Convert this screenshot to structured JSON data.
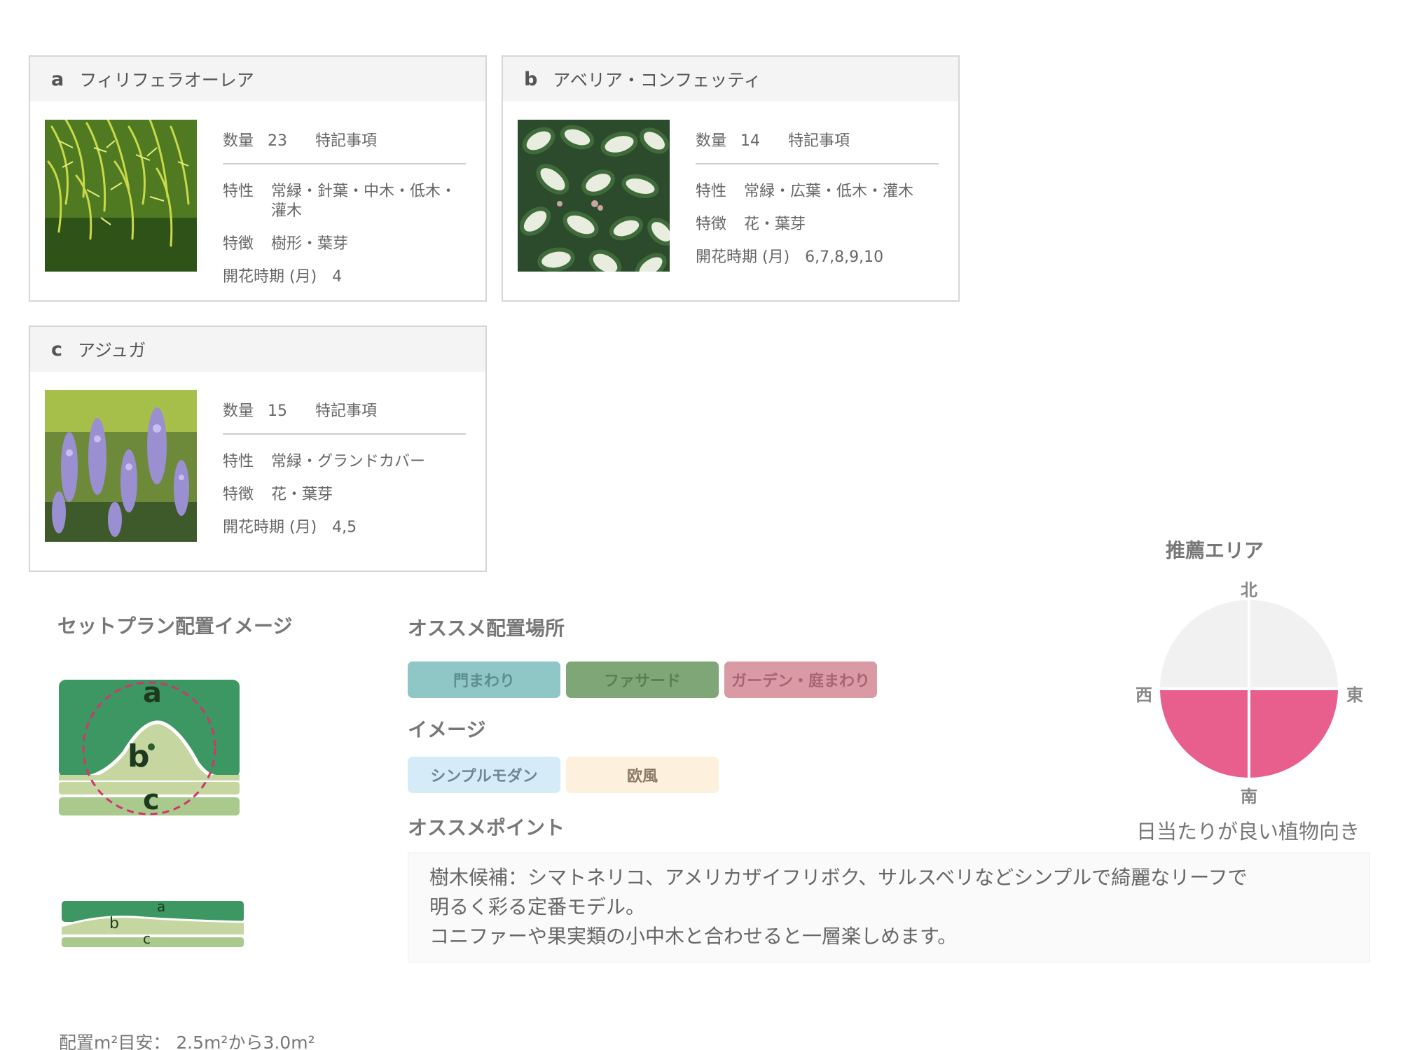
{
  "plants": [
    {
      "letter": "a",
      "name": "フィリフェラオーレア",
      "qty_label": "数量",
      "qty": "23",
      "note_label": "特記事項",
      "traits_label": "特性",
      "traits": "常緑・針葉・中木・低木・灌木",
      "features_label": "特徴",
      "features": "樹形・葉芽",
      "bloom_label": "開花時期 (月)",
      "bloom": "4",
      "photo_icon": "conifer-foliage-photo"
    },
    {
      "letter": "b",
      "name": "アベリア・コンフェッティ",
      "qty_label": "数量",
      "qty": "14",
      "note_label": "特記事項",
      "traits_label": "特性",
      "traits": "常緑・広葉・低木・灌木",
      "features_label": "特徴",
      "features": "花・葉芽",
      "bloom_label": "開花時期 (月)",
      "bloom": "6,7,8,9,10",
      "photo_icon": "variegated-leaves-photo"
    },
    {
      "letter": "c",
      "name": "アジュガ",
      "qty_label": "数量",
      "qty": "15",
      "note_label": "特記事項",
      "traits_label": "特性",
      "traits": "常緑・グランドカバー",
      "features_label": "特徴",
      "features": "花・葉芽",
      "bloom_label": "開花時期 (月)",
      "bloom": "4,5",
      "photo_icon": "purple-flower-photo"
    }
  ],
  "plan": {
    "title": "セットプラン配置イメージ",
    "labels": [
      "a",
      "b",
      "c"
    ],
    "area_text": "配置m²目安： 2.5m²から3.0m²"
  },
  "placement": {
    "title": "オススメ配置場所",
    "tags": [
      {
        "label": "門まわり",
        "bg": "#8fc6c6",
        "fg": "#5e8e8e"
      },
      {
        "label": "ファサード",
        "bg": "#7ea676",
        "fg": "#5a8052"
      },
      {
        "label": "ガーデン・庭まわり",
        "bg": "#d99aa6",
        "fg": "#a86474"
      }
    ]
  },
  "image": {
    "title": "イメージ",
    "tags": [
      {
        "label": "シンプルモダン",
        "bg": "#d5ecf8",
        "fg": "#6e8594"
      },
      {
        "label": "欧風",
        "bg": "#fdf0dc",
        "fg": "#8a7a66"
      }
    ]
  },
  "point": {
    "title": "オススメポイント",
    "lines": [
      "樹木候補：シマトネリコ、アメリカザイフリボク、サルスベリなどシンプルで綺麗なリーフで",
      "明るく彩る定番モデル。",
      "コニファーや果実類の小中木と合わせると一層楽しめます。"
    ]
  },
  "area": {
    "title": "推薦エリア",
    "north": "北",
    "south": "南",
    "east": "東",
    "west": "西",
    "caption": "日当たりが良い植物向き",
    "highlighted": [
      "south-east",
      "south-west"
    ],
    "active_color": "#e85f8e",
    "inactive_color": "#f1f1f1"
  }
}
